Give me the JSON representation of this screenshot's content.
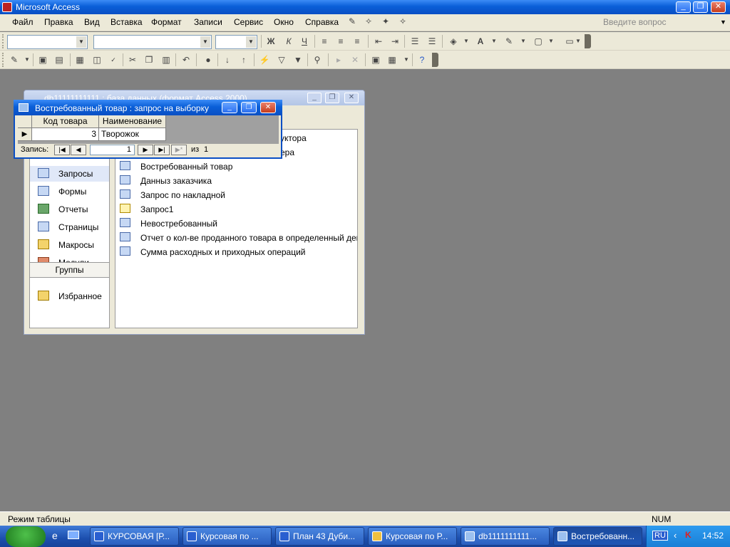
{
  "app": {
    "title": "Microsoft Access"
  },
  "window_controls": {
    "minimize": "_",
    "restore": "❐",
    "close": "✕"
  },
  "menu": {
    "items": [
      "Файл",
      "Правка",
      "Вид",
      "Вставка",
      "Формат",
      "Записи",
      "Сервис",
      "Окно",
      "Справка"
    ],
    "ask_placeholder": "Введите вопрос"
  },
  "toolbar_format": {
    "bold": "Ж",
    "italic": "К",
    "underline": "Ч"
  },
  "db_window": {
    "title": "db11111111111 : база данных (формат Access 2000)",
    "objects": [
      {
        "label": "Запросы",
        "icon": "query-icon"
      },
      {
        "label": "Формы",
        "icon": "form-icon"
      },
      {
        "label": "Отчеты",
        "icon": "report-icon"
      },
      {
        "label": "Страницы",
        "icon": "page-icon"
      },
      {
        "label": "Макросы",
        "icon": "macro-icon"
      },
      {
        "label": "Модули",
        "icon": "module-icon"
      }
    ],
    "groups_label": "Группы",
    "favorites_label": "Избранное",
    "list_items": [
      "уктора",
      "ера",
      "Востребованный товар",
      "Данныз заказчика",
      "Запрос по накладной",
      "Запрос1",
      "Невостребованный",
      "Отчет о кол-ве проданного товара в определенный ден",
      "Сумма расходных и приходных операций"
    ]
  },
  "query_window": {
    "title": "Востребованный товар : запрос на выборку",
    "columns": [
      "Код товара",
      "Наименование"
    ],
    "row": {
      "code": "3",
      "name": "Творожок"
    },
    "nav": {
      "label": "Запись:",
      "current": "1",
      "of": "из",
      "total": "1"
    }
  },
  "statusbar": {
    "mode": "Режим таблицы",
    "num": "NUM"
  },
  "taskbar": {
    "items": [
      "КУРСОВАЯ [Р...",
      "Курсовая по ...",
      "План 43 Дуби...",
      "Курсовая по Р...",
      "db1111111111...",
      "Востребованн..."
    ],
    "lang": "RU",
    "time": "14:52"
  }
}
